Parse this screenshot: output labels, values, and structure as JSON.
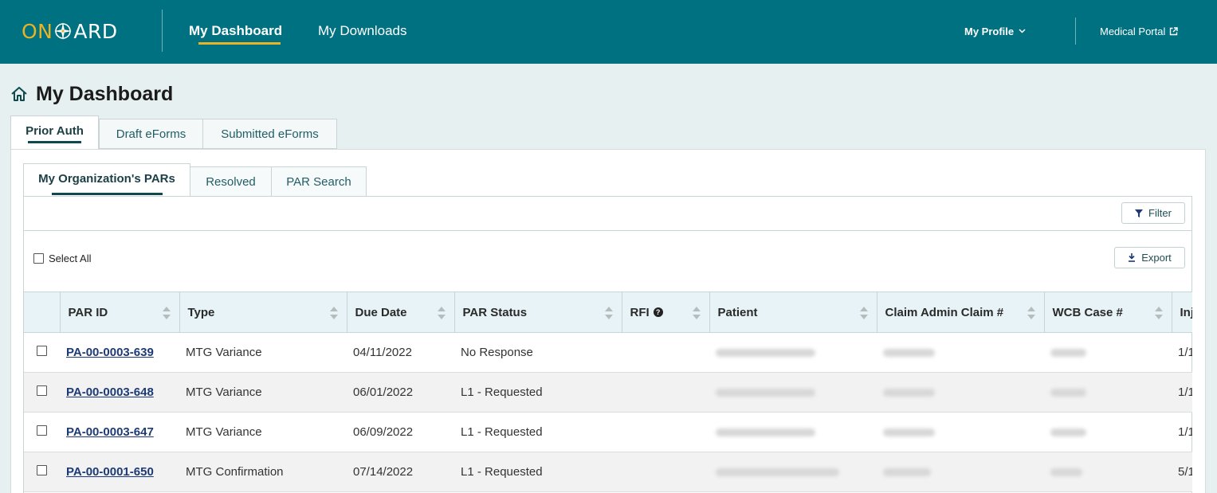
{
  "header": {
    "logo_left": "ON",
    "logo_right": "ARD",
    "nav": [
      {
        "label": "My Dashboard"
      },
      {
        "label": "My Downloads"
      }
    ],
    "profile_label": "My Profile",
    "portal_label": "Medical Portal",
    "colors": {
      "bar": "#007180",
      "accent": "#e8b324"
    }
  },
  "page": {
    "title": "My Dashboard",
    "outer_tabs": [
      "Prior Auth",
      "Draft eForms",
      "Submitted eForms"
    ],
    "inner_tabs": [
      "My Organization's PARs",
      "Resolved",
      "PAR Search"
    ]
  },
  "toolbar": {
    "filter_label": "Filter",
    "export_label": "Export",
    "select_all_label": "Select All"
  },
  "table": {
    "columns": [
      "PAR ID",
      "Type",
      "Due Date",
      "PAR Status",
      "RFI",
      "Patient",
      "Claim Admin Claim #",
      "WCB Case #",
      "Inj"
    ],
    "rows": [
      {
        "par_id": "PA-00-0003-639",
        "type": "MTG Variance",
        "due_date": "04/11/2022",
        "status": "No Response",
        "inj": "1/1"
      },
      {
        "par_id": "PA-00-0003-648",
        "type": "MTG Variance",
        "due_date": "06/01/2022",
        "status": "L1 - Requested",
        "inj": "1/1"
      },
      {
        "par_id": "PA-00-0003-647",
        "type": "MTG Variance",
        "due_date": "06/09/2022",
        "status": "L1 - Requested",
        "inj": "1/1"
      },
      {
        "par_id": "PA-00-0001-650",
        "type": "MTG Confirmation",
        "due_date": "07/14/2022",
        "status": "L1 - Requested",
        "inj": "5/1"
      }
    ]
  }
}
